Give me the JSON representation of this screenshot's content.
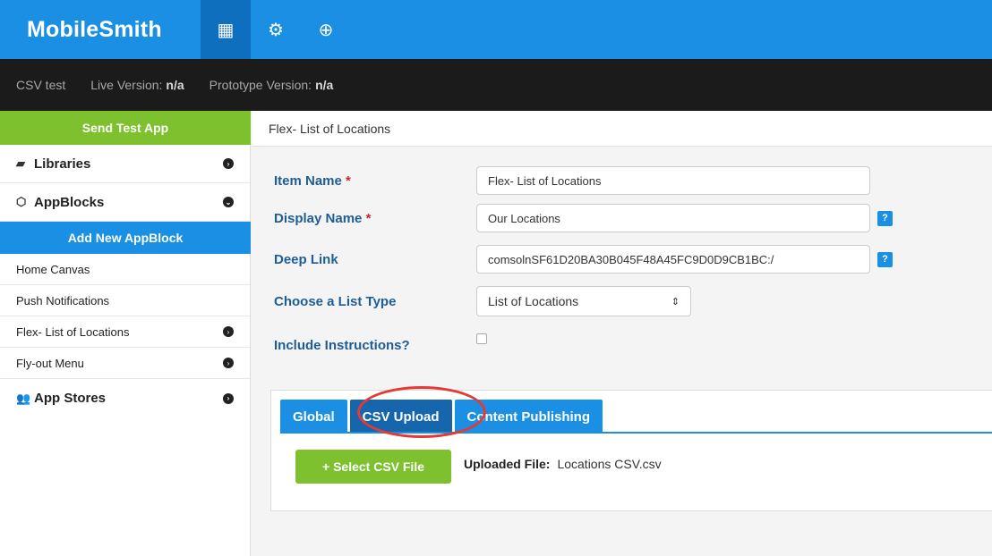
{
  "topbar": {
    "logo": "MobileSmith",
    "nav": [
      {
        "icon": "grid-icon",
        "glyph": "▦",
        "active": true
      },
      {
        "icon": "gears-icon",
        "glyph": "⚙",
        "active": false
      },
      {
        "icon": "lifebuoy-icon",
        "glyph": "⊕",
        "active": false
      }
    ]
  },
  "versionbar": {
    "app_name": "CSV test",
    "live_label": "Live Version:",
    "live_value": "n/a",
    "prototype_label": "Prototype Version:",
    "prototype_value": "n/a"
  },
  "sidebar": {
    "send_test_app": "Send Test App",
    "libraries": "Libraries",
    "appblocks": "AppBlocks",
    "add_new_appblock": "Add New AppBlock",
    "items": [
      {
        "label": "Home Canvas",
        "has_chevron": false
      },
      {
        "label": "Push Notifications",
        "has_chevron": false
      },
      {
        "label": "Flex- List of Locations",
        "has_chevron": true
      },
      {
        "label": "Fly-out Menu",
        "has_chevron": true
      }
    ],
    "app_stores": "App Stores"
  },
  "main": {
    "breadcrumb": "Flex- List of Locations",
    "item_name_label": "Item Name",
    "item_name_value": "Flex- List of Locations",
    "display_name_label": "Display Name",
    "display_name_value": "Our Locations",
    "deep_link_label": "Deep Link",
    "deep_link_value": "comsolnSF61D20BA30B045F48A45FC9D0D9CB1BC:/",
    "list_type_label": "Choose a List Type",
    "list_type_value": "List of Locations",
    "include_instructions_label": "Include Instructions?",
    "required_mark": "*",
    "help_mark": "?"
  },
  "tabs": {
    "global": "Global",
    "csv_upload": "CSV Upload",
    "content_publishing": "Content Publishing",
    "active": "csv_upload"
  },
  "csv": {
    "select_button": "+ Select CSV File",
    "uploaded_label": "Uploaded File:",
    "uploaded_value": "Locations CSV.csv"
  },
  "colors": {
    "primary_blue": "#1a8fe3",
    "active_tab": "#1666ad",
    "green": "#7dc12e",
    "dark_bar": "#1b1b1b",
    "label_blue": "#1f5d96",
    "highlight_red": "#e53935"
  }
}
